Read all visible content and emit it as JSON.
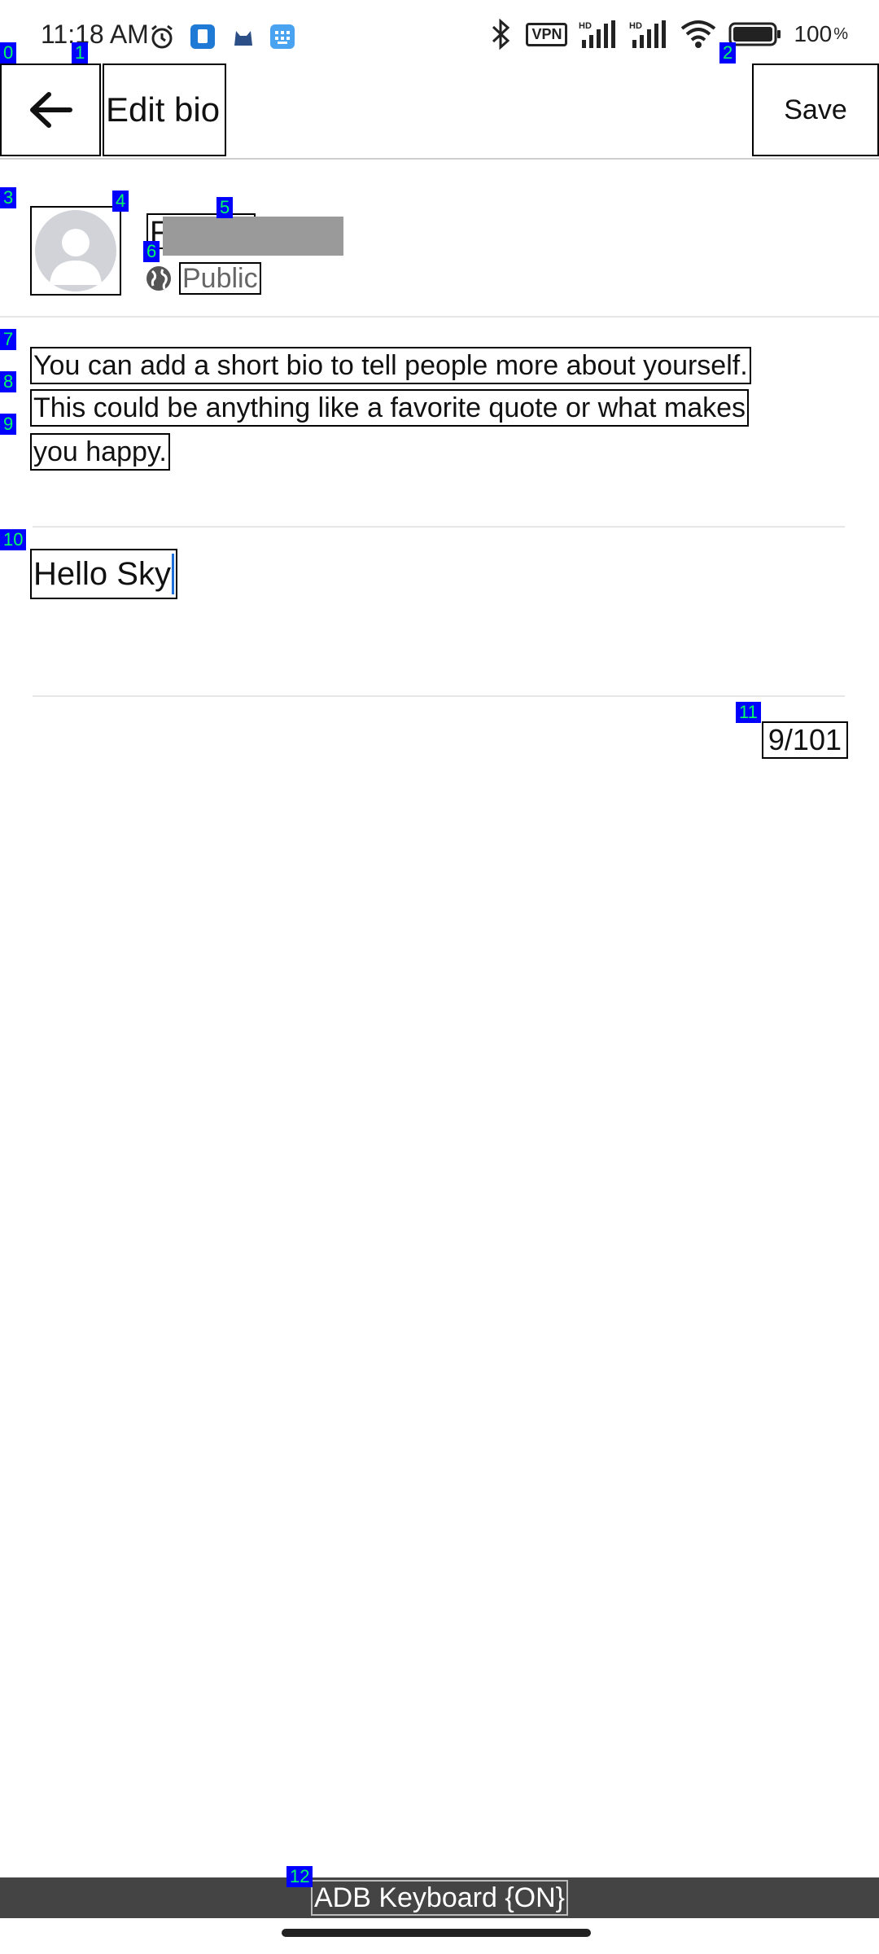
{
  "status_bar": {
    "time": "11:18 AM",
    "battery": "100",
    "vpn_label": "VPN",
    "hd_label": "HD"
  },
  "header": {
    "title": "Edit bio",
    "save_label": "Save"
  },
  "profile": {
    "name_visible": "F",
    "privacy": "Public"
  },
  "description": {
    "line1": "You can add a short bio to tell people more about yourself.",
    "line2": "This could be anything like a favorite quote or what makes",
    "line3": "you happy."
  },
  "bio": {
    "value": "Hello Sky",
    "count": "9/101"
  },
  "keyboard": {
    "label": "ADB Keyboard {ON}"
  },
  "markers": [
    "0",
    "1",
    "2",
    "3",
    "4",
    "5",
    "6",
    "7",
    "8",
    "9",
    "10",
    "11",
    "12"
  ]
}
